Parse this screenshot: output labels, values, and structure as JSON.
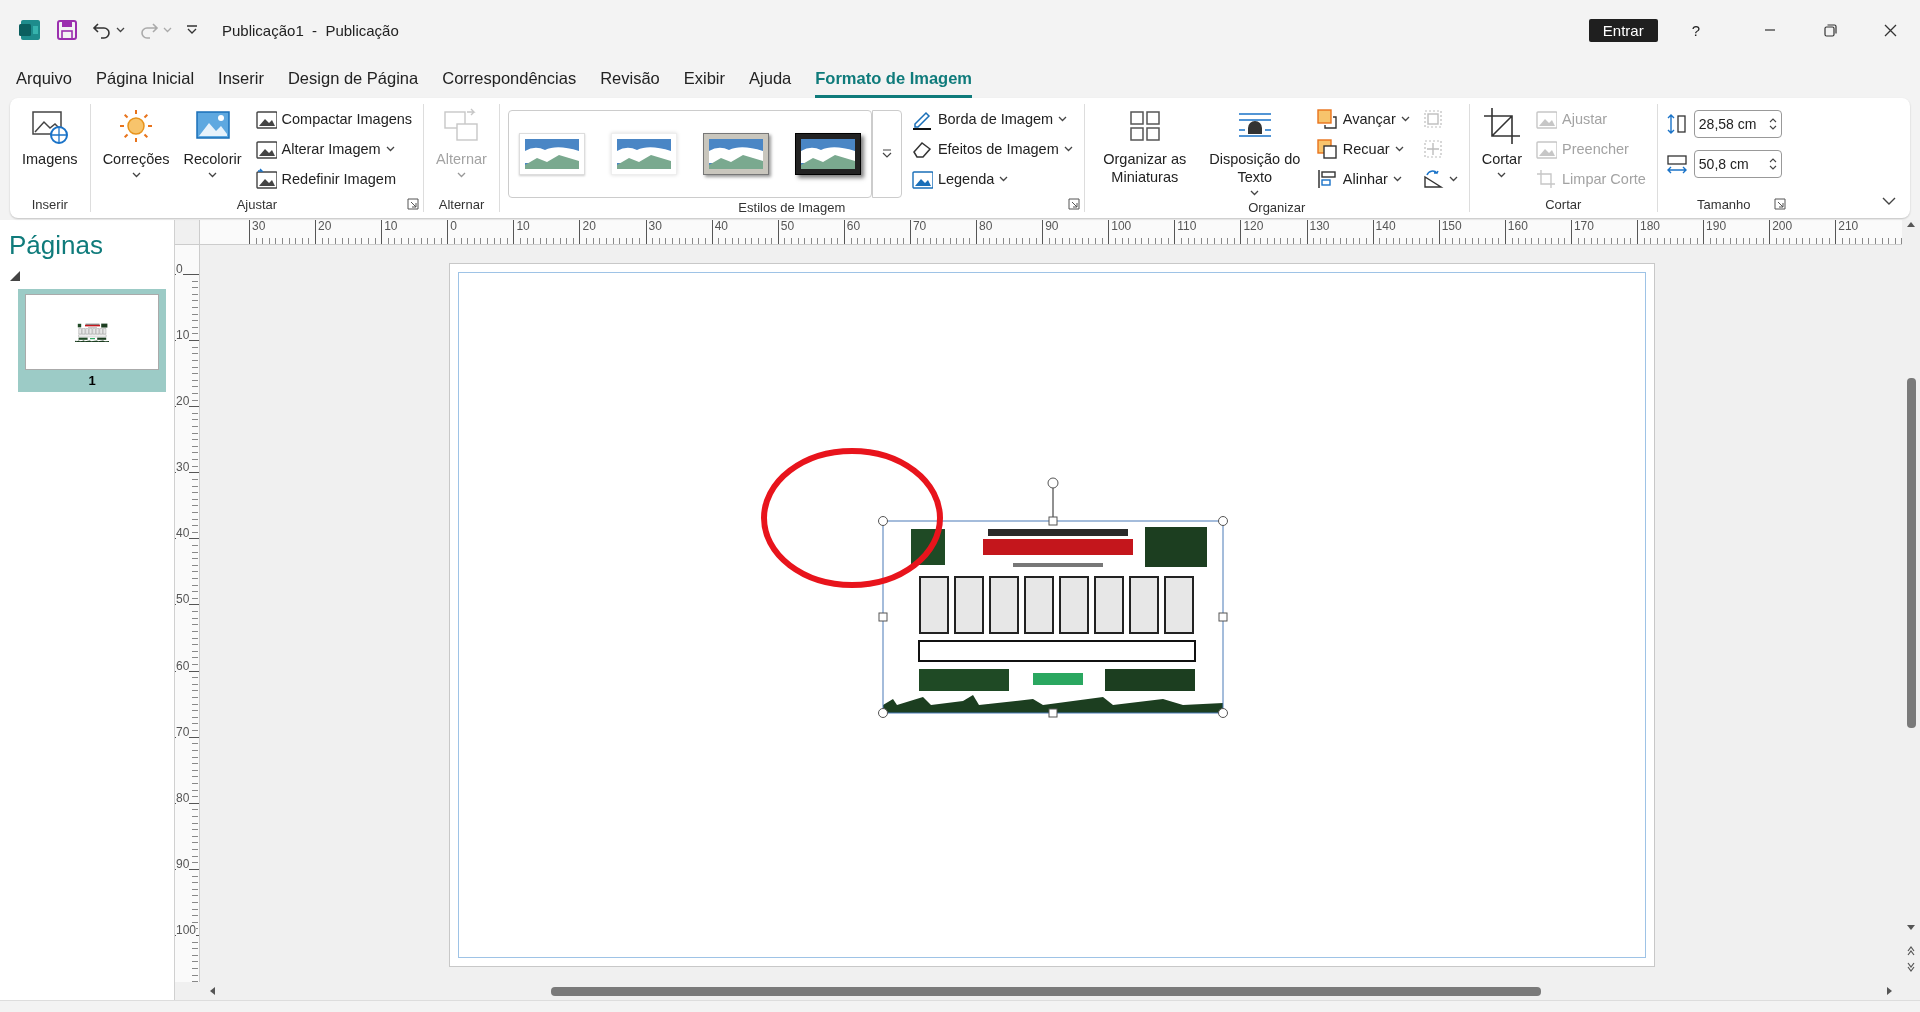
{
  "title_bar": {
    "title": "Publicação1  -  Publicação",
    "sign_in": "Entrar",
    "help": "?"
  },
  "tabs": [
    {
      "label": "Arquivo",
      "selected": false
    },
    {
      "label": "Página Inicial",
      "selected": false
    },
    {
      "label": "Inserir",
      "selected": false
    },
    {
      "label": "Design de Página",
      "selected": false
    },
    {
      "label": "Correspondências",
      "selected": false
    },
    {
      "label": "Revisão",
      "selected": false
    },
    {
      "label": "Exibir",
      "selected": false
    },
    {
      "label": "Ajuda",
      "selected": false
    },
    {
      "label": "Formato de Imagem",
      "selected": true
    }
  ],
  "ribbon": {
    "groups": [
      {
        "label": "Inserir",
        "launcher": false,
        "items": [
          {
            "kind": "large",
            "label": "Imagens",
            "dropdown": false,
            "disabled": false
          }
        ]
      },
      {
        "label": "Ajustar",
        "launcher": true,
        "items": [
          {
            "kind": "large",
            "label": "Correções",
            "dropdown": true,
            "disabled": false
          },
          {
            "kind": "large",
            "label": "Recolorir",
            "dropdown": true,
            "disabled": false
          },
          {
            "kind": "stack",
            "items": [
              {
                "kind": "button",
                "label": "Compactar Imagens",
                "dropdown": false,
                "disabled": false
              },
              {
                "kind": "button",
                "label": "Alterar Imagem",
                "dropdown": true,
                "disabled": false
              },
              {
                "kind": "button",
                "label": "Redefinir Imagem",
                "dropdown": false,
                "disabled": false
              }
            ]
          }
        ]
      },
      {
        "label": "Alternar",
        "launcher": false,
        "items": [
          {
            "kind": "large",
            "label": "Alternar",
            "dropdown": true,
            "disabled": true
          }
        ]
      },
      {
        "label": "Estilos de Imagem",
        "launcher": true,
        "items": [
          {
            "kind": "gallery",
            "styles": [
              {
                "kind": "plain"
              },
              {
                "kind": "soft"
              },
              {
                "kind": "framed"
              },
              {
                "kind": "shadow"
              }
            ]
          },
          {
            "kind": "stack",
            "items": [
              {
                "kind": "button",
                "label": "Borda de Imagem",
                "dropdown": true,
                "disabled": false
              },
              {
                "kind": "button",
                "label": "Efeitos de Imagem",
                "dropdown": true,
                "disabled": false
              },
              {
                "kind": "button",
                "label": "Legenda",
                "dropdown": true,
                "disabled": false
              }
            ]
          }
        ]
      },
      {
        "label": "Organizar",
        "launcher": false,
        "items": [
          {
            "kind": "large",
            "label": "Organizar as Miniaturas",
            "dropdown": false,
            "disabled": false
          },
          {
            "kind": "large",
            "label": "Disposição do Texto",
            "dropdown": true,
            "disabled": false
          },
          {
            "kind": "stack",
            "items": [
              {
                "kind": "button",
                "label": "Avançar",
                "dropdown": true,
                "disabled": false
              },
              {
                "kind": "button",
                "label": "Recuar",
                "dropdown": true,
                "disabled": false
              },
              {
                "kind": "button",
                "label": "Alinhar",
                "dropdown": true,
                "disabled": false
              }
            ]
          },
          {
            "kind": "stack",
            "items": [
              {
                "kind": "button",
                "dropdown": false,
                "disabled": true
              },
              {
                "kind": "button",
                "dropdown": false,
                "disabled": true
              },
              {
                "kind": "button",
                "dropdown": true,
                "disabled": false
              }
            ]
          }
        ]
      },
      {
        "label": "Cortar",
        "launcher": false,
        "items": [
          {
            "kind": "large",
            "label": "Cortar",
            "dropdown": true,
            "disabled": false
          },
          {
            "kind": "stack",
            "items": [
              {
                "kind": "button",
                "label": "Ajustar",
                "dropdown": false,
                "disabled": true
              },
              {
                "kind": "button",
                "label": "Preencher",
                "dropdown": false,
                "disabled": true
              },
              {
                "kind": "button",
                "label": "Limpar Corte",
                "dropdown": false,
                "disabled": true
              }
            ]
          }
        ]
      },
      {
        "label": "Tamanho",
        "launcher": true,
        "items": [
          {
            "kind": "stack",
            "items": [
              {
                "kind": "spin",
                "value": "28,58 cm"
              },
              {
                "kind": "spin",
                "value": "50,8 cm"
              }
            ]
          }
        ]
      }
    ]
  },
  "pages_pane": {
    "title": "Páginas",
    "pages": [
      {
        "number": "1",
        "selected": true
      }
    ]
  },
  "rulers": {
    "horizontal": [
      "30",
      "20",
      "10",
      "0",
      "10",
      "20",
      "30",
      "40",
      "50",
      "60",
      "70",
      "80",
      "90",
      "100",
      "110",
      "120",
      "130",
      "140",
      "150",
      "160",
      "170",
      "180",
      "190",
      "200",
      "210"
    ],
    "vertical": [
      "0",
      "10",
      "20",
      "30",
      "40",
      "50",
      "60",
      "70",
      "80",
      "90",
      "100"
    ]
  },
  "document": {
    "picture": {
      "kind": "picture",
      "selected": true
    },
    "shapes": [
      {
        "kind": "ellipse",
        "color": "#e8141c"
      }
    ]
  }
}
